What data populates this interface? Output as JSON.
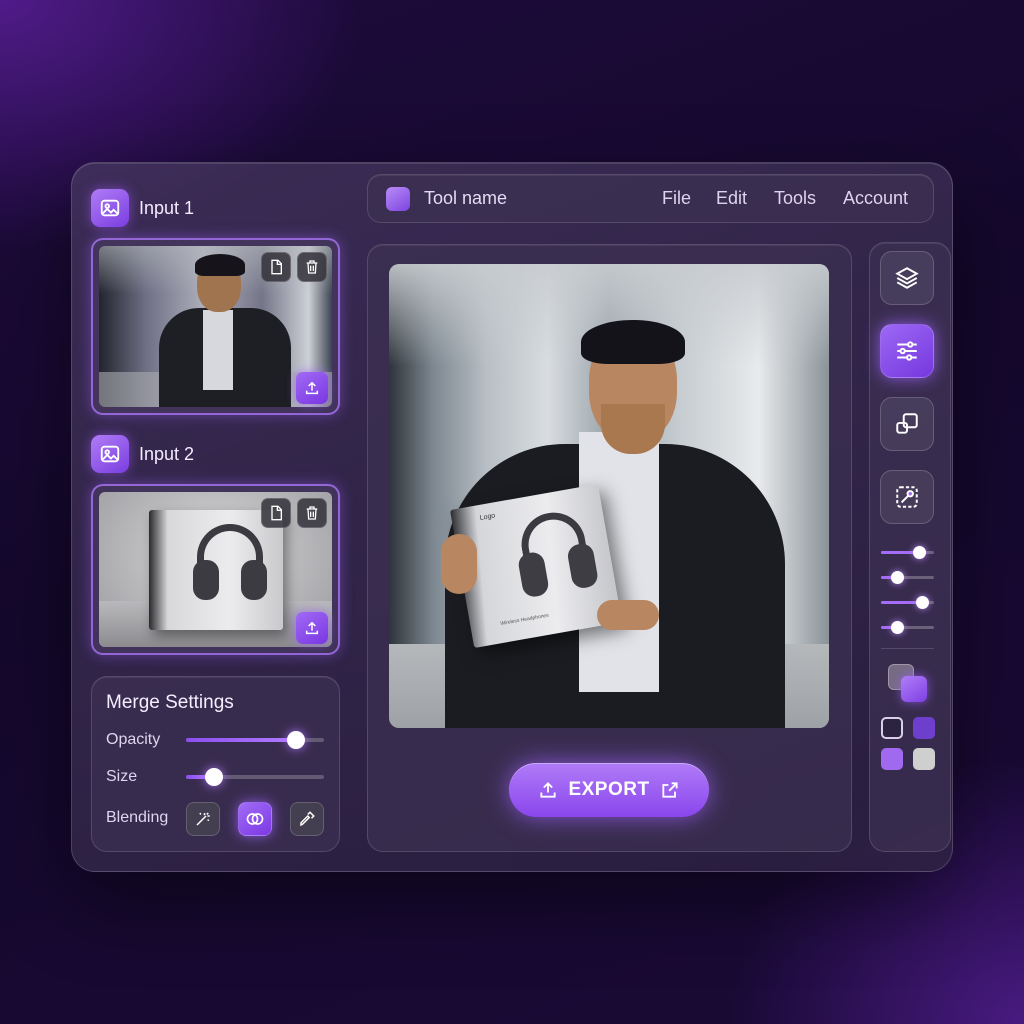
{
  "app": {
    "tool_name": "Tool name",
    "menu": [
      "File",
      "Edit",
      "Tools",
      "Account"
    ]
  },
  "inputs": [
    {
      "title": "Input 1",
      "image": "man-in-suit-office-photo",
      "actions": [
        "file-icon",
        "trash-icon",
        "upload-icon"
      ]
    },
    {
      "title": "Input 2",
      "image": "headphones-box-product-photo",
      "actions": [
        "file-icon",
        "trash-icon",
        "upload-icon"
      ]
    }
  ],
  "merge": {
    "title": "Merge Settings",
    "opacity_label": "Opacity",
    "opacity_value": 0.8,
    "size_label": "Size",
    "size_value": 0.2,
    "blending_label": "Blending",
    "blending_modes": [
      "magic-wand-icon",
      "overlap-circles-icon",
      "eyedropper-icon"
    ],
    "blending_active": 1
  },
  "preview": {
    "image": "man-holding-headphones-box-office-photo",
    "box_logo": "Logo",
    "box_small_text": "Wireless Headphones"
  },
  "export": {
    "label": "EXPORT"
  },
  "toolbar": {
    "tools": [
      "layers-icon",
      "sliders-icon",
      "arrange-icon",
      "transform-icon"
    ],
    "active_tool": 1,
    "mini_sliders": [
      0.72,
      0.3,
      0.78,
      0.3
    ],
    "swatches": [
      "#2b2340",
      "#6d3fcc",
      "#a168f0",
      "#cfcfcf"
    ],
    "accent": "#8b4df0"
  }
}
